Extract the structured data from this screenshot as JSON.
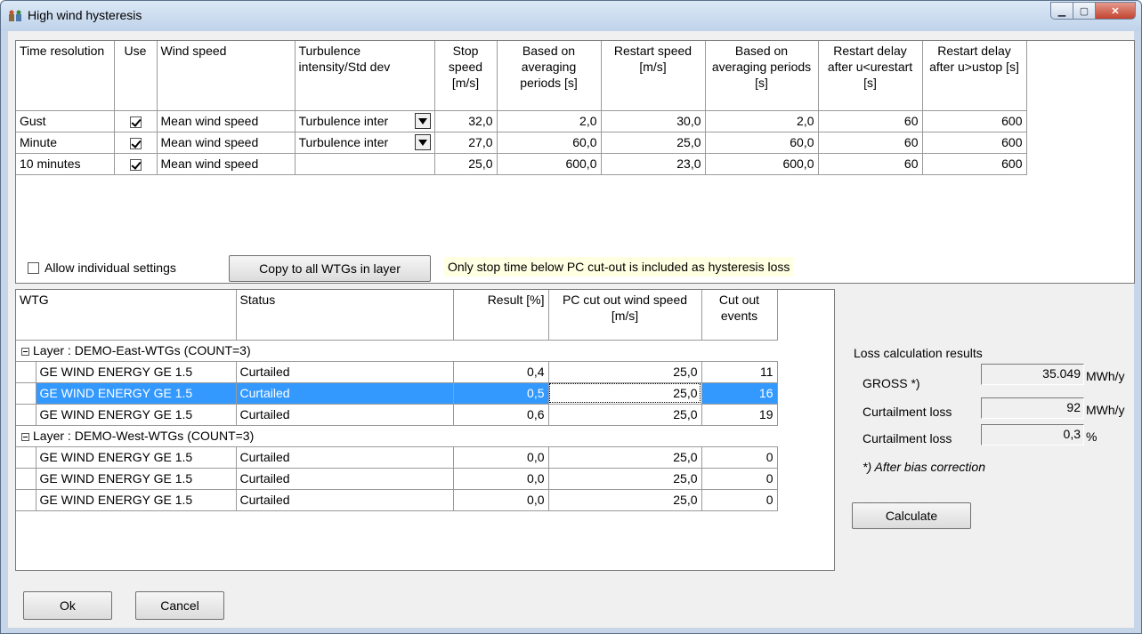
{
  "window": {
    "title": "High wind hysteresis",
    "controls": [
      "minimize-icon",
      "maximize-icon",
      "close-icon"
    ]
  },
  "settings_table": {
    "headers": [
      "Time resolution",
      "Use",
      "Wind speed",
      "Turbulence intensity/Std dev",
      "Stop speed [m/s]",
      "Based on averaging periods [s]",
      "Restart speed [m/s]",
      "Based on averaging periods [s]",
      "Restart delay after u<urestart [s]",
      "Restart delay after u>ustop [s]"
    ],
    "rows": [
      {
        "time": "Gust",
        "use": true,
        "wind": "Mean wind speed",
        "turb": "Turbulence inter",
        "stop": "32,0",
        "avg1": "2,0",
        "restart": "30,0",
        "avg2": "2,0",
        "delay1": "60",
        "delay2": "600"
      },
      {
        "time": "Minute",
        "use": true,
        "wind": "Mean wind speed",
        "turb": "Turbulence inter",
        "stop": "27,0",
        "avg1": "60,0",
        "restart": "25,0",
        "avg2": "60,0",
        "delay1": "60",
        "delay2": "600"
      },
      {
        "time": "10 minutes",
        "use": true,
        "wind": "Mean wind speed",
        "turb": "",
        "stop": "25,0",
        "avg1": "600,0",
        "restart": "23,0",
        "avg2": "600,0",
        "delay1": "60",
        "delay2": "600"
      }
    ]
  },
  "allow_individual": {
    "label": "Allow individual settings",
    "checked": false
  },
  "copy_button": "Copy to all WTGs in layer",
  "note": "Only stop time below PC cut-out is included as hysteresis loss",
  "wtg_table": {
    "headers": [
      "WTG",
      "Status",
      "Result [%]",
      "PC cut out wind speed [m/s]",
      "Cut out events"
    ],
    "layers": [
      {
        "label": "Layer : DEMO-East-WTGs (COUNT=3)",
        "rows": [
          {
            "wtg": "GE WIND ENERGY GE 1.5",
            "status": "Curtailed",
            "result": "0,4",
            "pc": "25,0",
            "events": "11"
          },
          {
            "wtg": "GE WIND ENERGY GE 1.5",
            "status": "Curtailed",
            "result": "0,5",
            "pc": "25,0",
            "events": "16"
          },
          {
            "wtg": "GE WIND ENERGY GE 1.5",
            "status": "Curtailed",
            "result": "0,6",
            "pc": "25,0",
            "events": "19"
          }
        ]
      },
      {
        "label": "Layer : DEMO-West-WTGs (COUNT=3)",
        "rows": [
          {
            "wtg": "GE WIND ENERGY GE 1.5",
            "status": "Curtailed",
            "result": "0,0",
            "pc": "25,0",
            "events": "0"
          },
          {
            "wtg": "GE WIND ENERGY GE 1.5",
            "status": "Curtailed",
            "result": "0,0",
            "pc": "25,0",
            "events": "0"
          },
          {
            "wtg": "GE WIND ENERGY GE 1.5",
            "status": "Curtailed",
            "result": "0,0",
            "pc": "25,0",
            "events": "0"
          }
        ]
      }
    ]
  },
  "results": {
    "title": "Loss calculation results",
    "gross": {
      "label": "GROSS *)",
      "value": "35.049",
      "unit": "MWh/y"
    },
    "curtail_abs": {
      "label": "Curtailment loss",
      "value": "92",
      "unit": "MWh/y"
    },
    "curtail_pct": {
      "label": "Curtailment loss",
      "value": "0,3",
      "unit": "%"
    },
    "footnote": "*) After bias correction"
  },
  "buttons": {
    "calculate": "Calculate",
    "ok": "Ok",
    "cancel": "Cancel"
  },
  "colors": {
    "selection": "#3399ff",
    "note_bg": "#ffffe1",
    "titlebar": "#c6d6e8"
  }
}
